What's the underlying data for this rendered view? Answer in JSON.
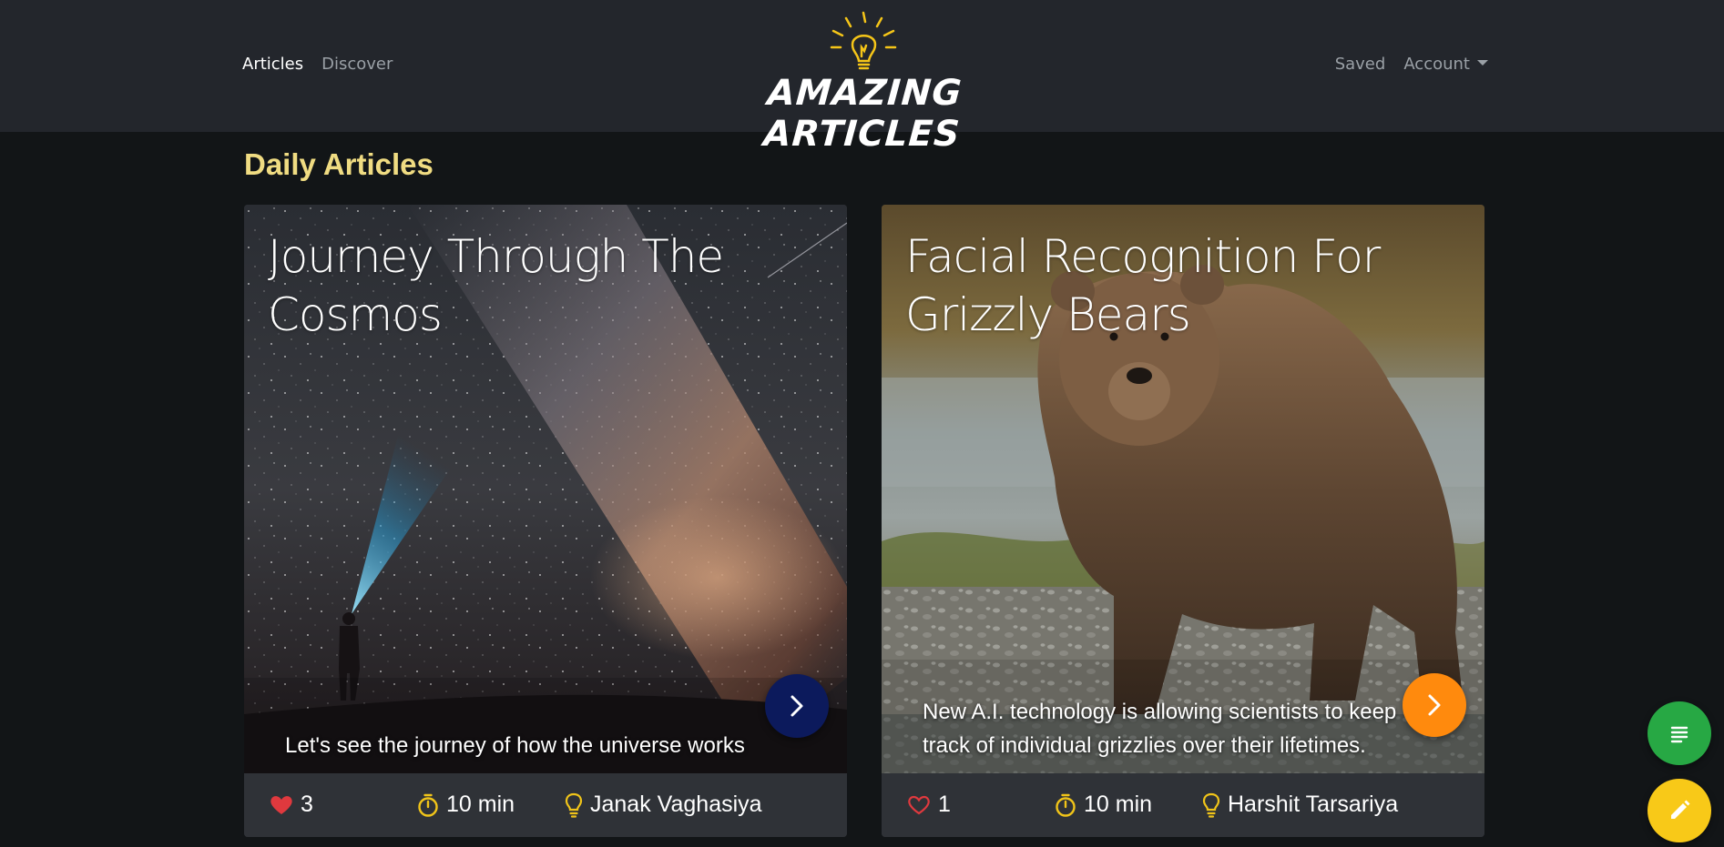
{
  "nav": {
    "left": [
      {
        "label": "Articles",
        "active": true
      },
      {
        "label": "Discover",
        "active": false
      }
    ],
    "right": {
      "saved_label": "Saved",
      "account_label": "Account"
    },
    "logo_text": "AMAZING ARTICLES"
  },
  "section_title": "Daily Articles",
  "cards": [
    {
      "title": "Journey Through The Cosmos",
      "description": "Let's see the journey of how the universe works",
      "likes": "3",
      "liked": true,
      "read_time": "10 min",
      "author": "Janak Vaghasiya",
      "button_color": "#0c1a5c"
    },
    {
      "title": "Facial Recognition For Grizzly Bears",
      "description": "New A.I. technology is allowing scientists to keep track of individual grizzlies over their lifetimes.",
      "likes": "1",
      "liked": false,
      "read_time": "10 min",
      "author": "Harshit Tarsariya",
      "button_color": "#ff8a0d"
    }
  ],
  "colors": {
    "navbar": "#23262c",
    "background": "#121517",
    "accent_title": "#f0dc82",
    "heart": "#e0393e",
    "stat_icon": "#f0c419",
    "fab_articles": "#27a844",
    "fab_write": "#f8c918"
  },
  "icons": {
    "likes": "heart-icon",
    "time": "stopwatch-icon",
    "author": "lightbulb-icon",
    "go": "chevron-right-icon",
    "articles_fab": "notes-icon",
    "write_fab": "pencil-icon"
  }
}
